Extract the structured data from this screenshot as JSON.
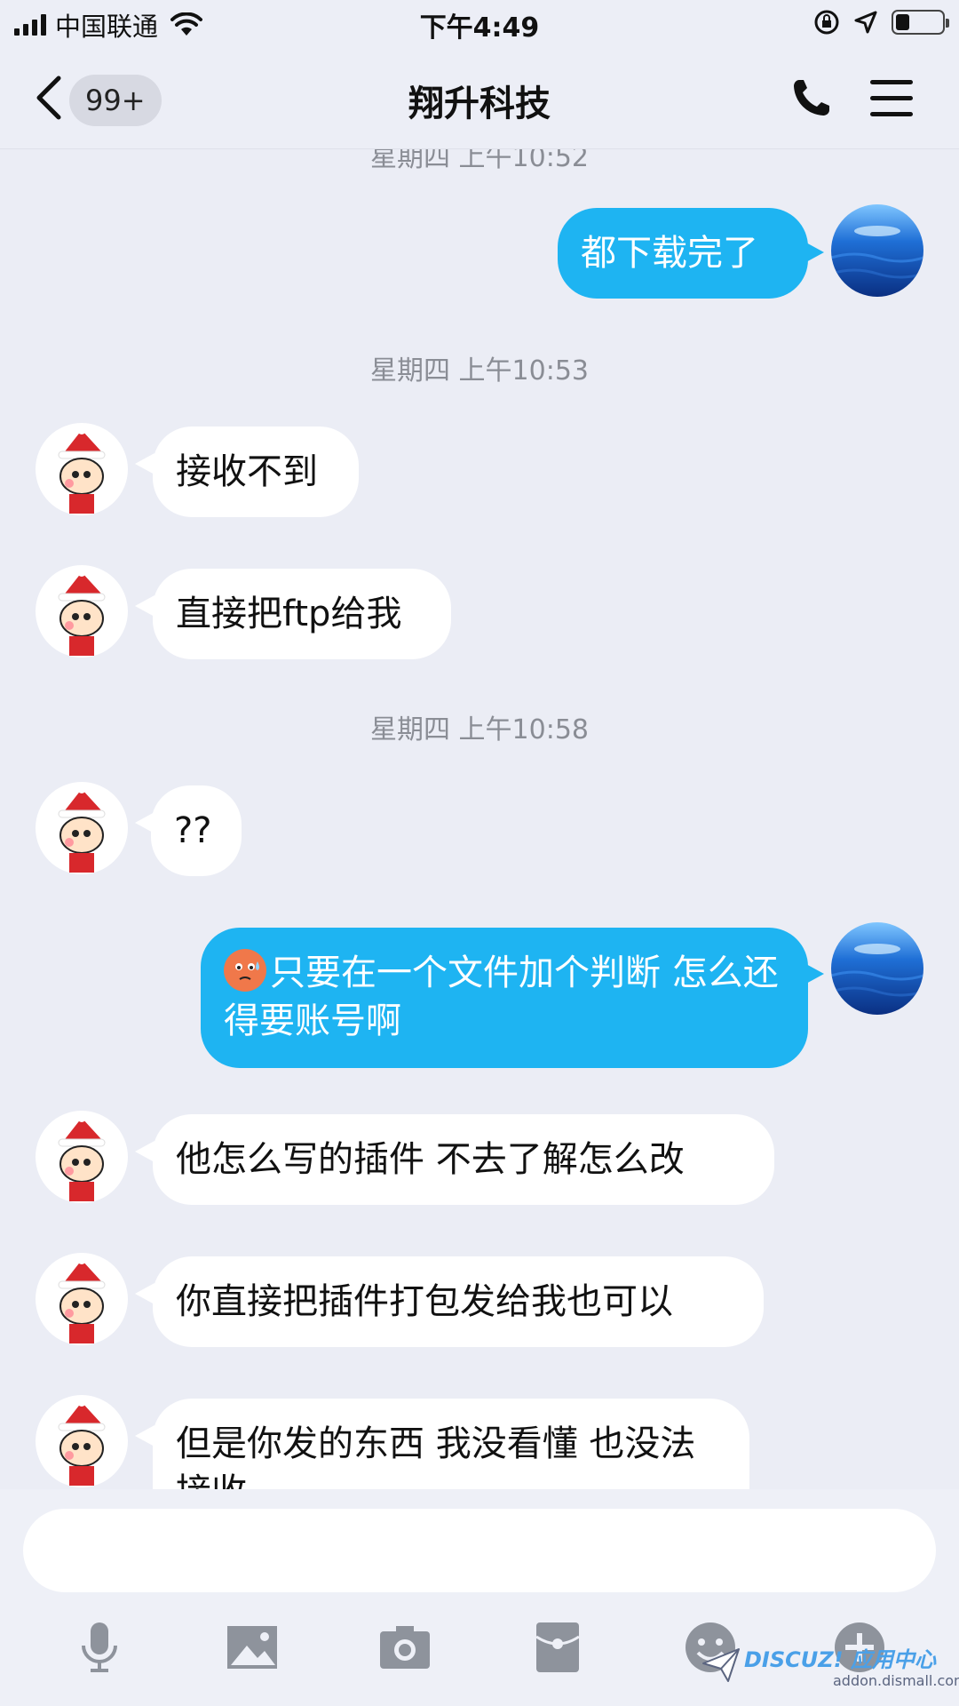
{
  "status_bar": {
    "carrier": "中国联通",
    "time": "下午4:49",
    "battery_level": 0.3
  },
  "nav": {
    "unread_badge": "99+",
    "title": "翔升科技"
  },
  "messages": {
    "partial_timestamp": "星期四 上午10:52",
    "out_1": "都下载完了",
    "ts_1": "星期四 上午10:53",
    "in_1": "接收不到",
    "in_2": "直接把ftp给我",
    "ts_2": "星期四 上午10:58",
    "in_3": "??",
    "out_2": "只要在一个文件加个判断  怎么还得要账号啊",
    "in_4": "他怎么写的插件 不去了解怎么改",
    "in_5": "你直接把插件打包发给我也可以",
    "in_6": "但是你发的东西 我没看懂 也没法接收"
  },
  "input": {
    "value": ""
  },
  "toolbar": {
    "icons": [
      "microphone-icon",
      "image-icon",
      "camera-icon",
      "red-packet-icon",
      "emoji-icon",
      "plus-icon"
    ]
  },
  "watermark": {
    "brand": "DISCUZ! 应用中心",
    "url": "addon.dismall.com"
  },
  "colors": {
    "accent": "#1eb4f2",
    "background": "#ebedf5",
    "incoming_bubble": "#ffffff"
  }
}
